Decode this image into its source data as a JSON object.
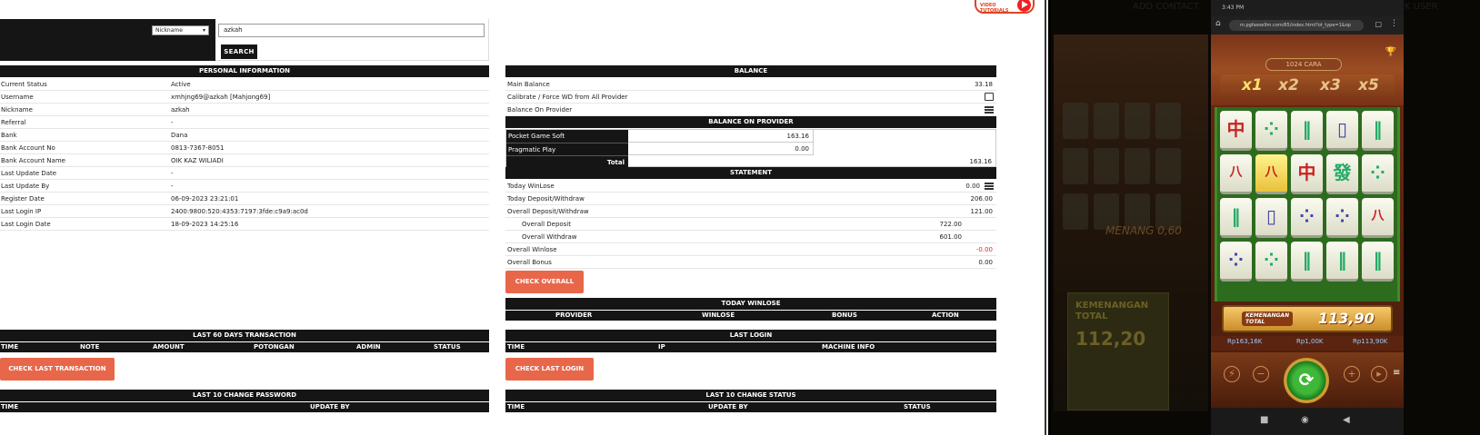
{
  "search": {
    "field_option": "Nickname",
    "query": "azkah",
    "button": "SEARCH"
  },
  "video_badge": {
    "line1": "VIDEO",
    "line2": "TUTORIALS"
  },
  "personal": {
    "title": "PERSONAL INFORMATION",
    "rows": [
      {
        "k": "Current Status",
        "v": "Active"
      },
      {
        "k": "Username",
        "v": "xmhjng69@azkah  [Mahjong69]"
      },
      {
        "k": "Nickname",
        "v": "azkah"
      },
      {
        "k": "Referral",
        "v": "-"
      },
      {
        "k": "Bank",
        "v": "Dana"
      },
      {
        "k": "Bank Account No",
        "v": "0813-7367-8051"
      },
      {
        "k": "Bank Account Name",
        "v": "OIK KAZ WILIADI"
      },
      {
        "k": "Last Update Date",
        "v": "-"
      },
      {
        "k": "Last Update By",
        "v": "-"
      },
      {
        "k": "Register Date",
        "v": "06-09-2023 23:21:01"
      },
      {
        "k": "Last Login IP",
        "v": "2400:9800:520:4353:7197:3fde:c9a9:ac0d"
      },
      {
        "k": "Last Login Date",
        "v": "18-09-2023 14:25:16"
      }
    ]
  },
  "balance": {
    "title": "BALANCE",
    "main_label": "Main Balance",
    "main_value": "33.18",
    "calibrate_label": "Calibrate / Force WD from All Provider",
    "provider_label": "Balance On Provider"
  },
  "bop": {
    "title": "BALANCE ON PROVIDER",
    "rows": [
      {
        "name": "Pocket Game Soft",
        "value": "163.16"
      },
      {
        "name": "Pragmatic Play",
        "value": "0.00"
      }
    ],
    "total_label": "Total",
    "total_value": "163.16"
  },
  "statement": {
    "title": "STATEMENT",
    "today_winlose_label": "Today WinLose",
    "today_winlose": "0.00",
    "today_dw_label": "Today Deposit/Withdraw",
    "today_dw": "206.00",
    "overall_dw_label": "Overall Deposit/Withdraw",
    "overall_dw": "121.00",
    "overall_dep_label": "Overall Deposit",
    "overall_dep": "722.00",
    "overall_wd_label": "Overall Withdraw",
    "overall_wd": "601.00",
    "overall_winlose_label": "Overall Winlose",
    "overall_winlose": "-0.00",
    "overall_bonus_label": "Overall Bonus",
    "overall_bonus": "0.00",
    "check_overall": "CHECK OVERALL"
  },
  "today_winlose": {
    "title": "TODAY WINLOSE",
    "cols": [
      "PROVIDER",
      "WINLOSE",
      "BONUS",
      "ACTION"
    ]
  },
  "last60": {
    "title": "LAST 60 DAYS TRANSACTION",
    "cols": [
      "TIME",
      "NOTE",
      "AMOUNT",
      "POTONGAN",
      "ADMIN",
      "STATUS"
    ],
    "button": "CHECK LAST TRANSACTION"
  },
  "lastlogin": {
    "title": "LAST LOGIN",
    "cols": [
      "TIME",
      "IP",
      "MACHINE INFO"
    ],
    "button": "CHECK LAST LOGIN"
  },
  "pwchange": {
    "title": "LAST 10 CHANGE PASSWORD",
    "cols": [
      "TIME",
      "UPDATE BY"
    ]
  },
  "statuschange": {
    "title": "LAST 10 CHANGE STATUS",
    "cols": [
      "TIME",
      "UPDATE BY",
      "STATUS"
    ]
  },
  "phone": {
    "status_time": "3:43 PM",
    "url": "m.pgfasoe9m.com/65/index.html?ot_type=1&op",
    "cara": "1024 CARA",
    "multipliers": [
      "x1",
      "x2",
      "x3",
      "x5"
    ],
    "win_label_1": "KEMENANGAN",
    "win_label_2": "TOTAL",
    "win_value": "113,90",
    "balance": "Rp163,16K",
    "bet": "Rp1,00K",
    "win": "Rp113,90K",
    "bg_menang": "MENANG 0,60",
    "bg_box_label_1": "KEMENANGAN",
    "bg_box_label_2": "TOTAL",
    "bg_box_value": "112,20",
    "bg_text_left": "ADD CONTACT",
    "bg_text_right": "BLOCK USER"
  }
}
